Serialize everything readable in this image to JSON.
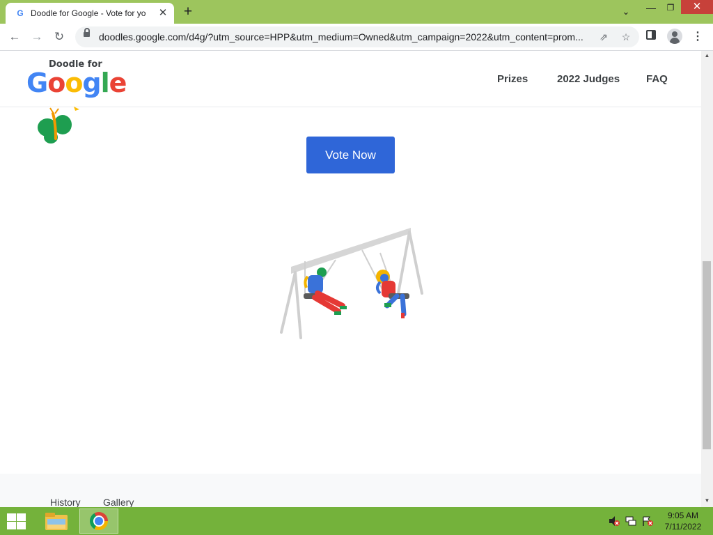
{
  "browser": {
    "tab": {
      "title": "Doodle for Google - Vote for yo",
      "favicon": "google-g-icon"
    },
    "url": "doodles.google.com/d4g/?utm_source=HPP&utm_medium=Owned&utm_campaign=2022&utm_content=prom...",
    "theme_color": "#9dc55d"
  },
  "site": {
    "logo": {
      "top_text": "Doodle for",
      "brand": [
        "G",
        "o",
        "o",
        "g",
        "l",
        "e"
      ],
      "brand_colors": [
        "#4285f4",
        "#ea4335",
        "#fbbc05",
        "#4285f4",
        "#34a853",
        "#ea4335"
      ]
    },
    "nav": [
      {
        "label": "Prizes"
      },
      {
        "label": "2022 Judges"
      },
      {
        "label": "FAQ"
      }
    ]
  },
  "main": {
    "cta": {
      "label": "Vote Now",
      "color": "#2f66d8"
    },
    "illustration": "swing-set-illustration"
  },
  "footer": {
    "links": [
      {
        "label": "History"
      },
      {
        "label": "Gallery"
      }
    ]
  },
  "taskbar": {
    "clock": {
      "time": "9:05 AM",
      "date": "7/11/2022"
    },
    "tray_icons": [
      "volume-muted-icon",
      "network-icon",
      "action-center-flag-icon"
    ]
  }
}
